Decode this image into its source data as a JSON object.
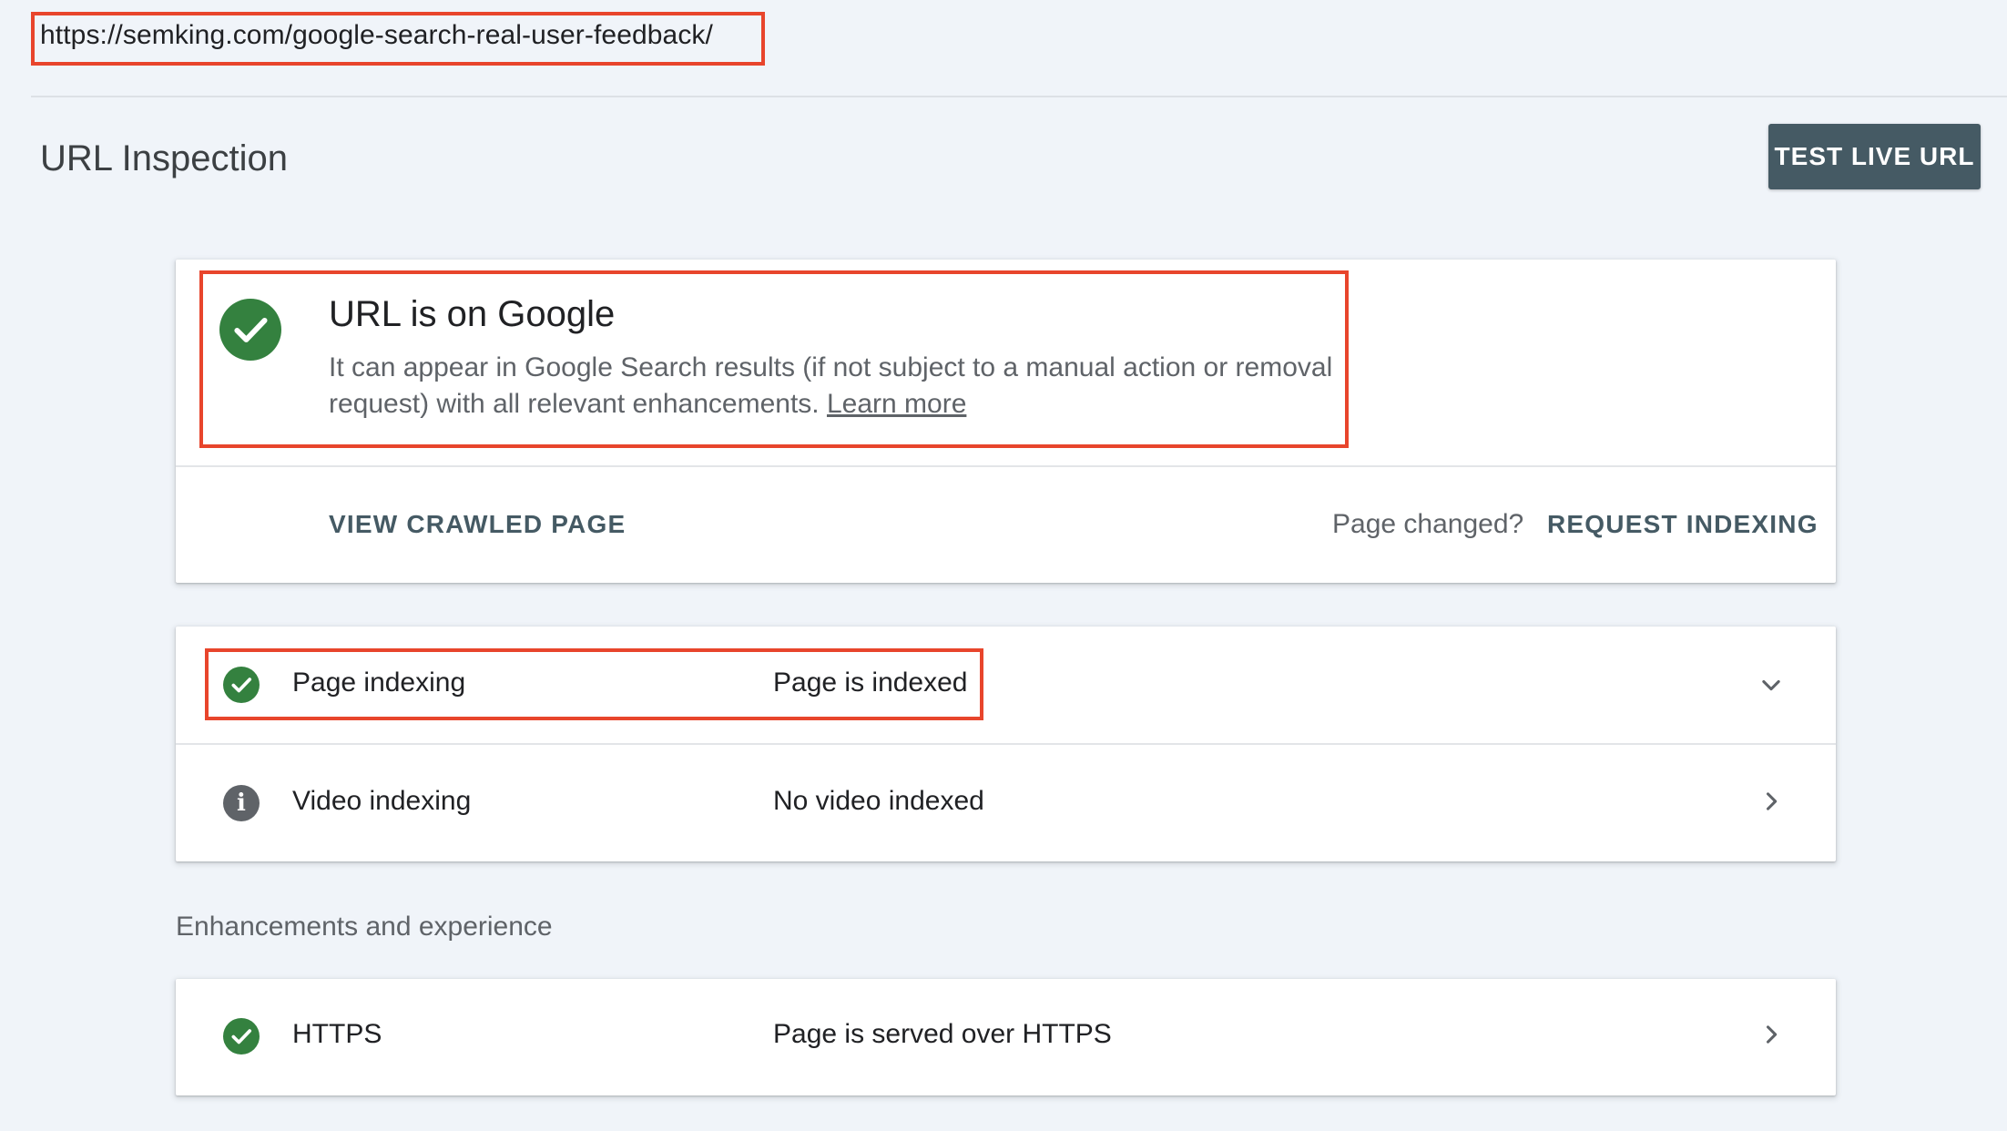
{
  "url_bar": {
    "url": "https://semking.com/google-search-real-user-feedback/"
  },
  "header": {
    "title": "URL Inspection",
    "test_live_url_label": "TEST LIVE URL"
  },
  "status_card": {
    "title": "URL is on Google",
    "description_line1": "It can appear in Google Search results (if not subject to a manual action or removal",
    "description_line2": "request) with all relevant enhancements.",
    "learn_more": "Learn more",
    "view_crawled_label": "VIEW CRAWLED PAGE",
    "page_changed_text": "Page changed?",
    "request_indexing_label": "REQUEST INDEXING",
    "status_color": "#34813f"
  },
  "indexing_card": {
    "rows": [
      {
        "label": "Page indexing",
        "value": "Page is indexed",
        "icon": "check-circle-icon",
        "chevron": "chevron-down-icon"
      },
      {
        "label": "Video indexing",
        "value": "No video indexed",
        "icon": "info-circle-icon",
        "chevron": "chevron-right-icon"
      }
    ]
  },
  "enhancements": {
    "section_label": "Enhancements and experience",
    "rows": [
      {
        "label": "HTTPS",
        "value": "Page is served over HTTPS",
        "icon": "check-circle-icon",
        "chevron": "chevron-right-icon"
      }
    ]
  },
  "colors": {
    "highlight": "#e8452c",
    "success": "#34813f",
    "button_bg": "#455a64",
    "page_bg": "#f0f4f9"
  }
}
